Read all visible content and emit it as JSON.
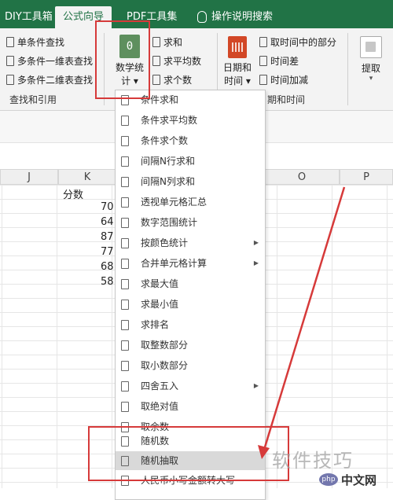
{
  "tabs": [
    {
      "label": "DIY工具箱"
    },
    {
      "label": "公式向导"
    },
    {
      "label": "PDF工具集"
    },
    {
      "label": "操作说明搜索"
    }
  ],
  "ribbon": {
    "lookup_group": {
      "items": [
        "单条件查找",
        "多条件一维表查找",
        "多条件二维表查找"
      ],
      "label": "查找和引用"
    },
    "math_button": {
      "icon_text": "0",
      "line1": "数学统",
      "line2": "计 ▾"
    },
    "math_small": [
      "求和",
      "求平均数",
      "求个数"
    ],
    "date_button": {
      "line1": "日期和",
      "line2": "时间 ▾"
    },
    "date_items": [
      "取时间中的部分",
      "时间差",
      "时间加减"
    ],
    "date_group_label": "期和时间",
    "extract_button": {
      "line1": "提取",
      "line2": "▾"
    }
  },
  "sheet": {
    "columns": [
      "J",
      "K",
      "O",
      "P"
    ],
    "header_cell": "分数",
    "values": [
      "70",
      "64",
      "87",
      "77",
      "68",
      "58"
    ]
  },
  "menu": {
    "items": [
      {
        "label": "条件求和",
        "arrow": ""
      },
      {
        "label": "条件求平均数",
        "arrow": ""
      },
      {
        "label": "条件求个数",
        "arrow": ""
      },
      {
        "label": "间隔N行求和",
        "arrow": ""
      },
      {
        "label": "间隔N列求和",
        "arrow": ""
      },
      {
        "label": "透视单元格汇总",
        "arrow": ""
      },
      {
        "label": "数字范围统计",
        "arrow": ""
      },
      {
        "label": "按颜色统计",
        "arrow": "▶"
      },
      {
        "label": "合并单元格计算",
        "arrow": "▶"
      },
      {
        "label": "求最大值",
        "arrow": ""
      },
      {
        "label": "求最小值",
        "arrow": ""
      },
      {
        "label": "求排名",
        "arrow": ""
      },
      {
        "label": "取整数部分",
        "arrow": ""
      },
      {
        "label": "取小数部分",
        "arrow": ""
      },
      {
        "label": "四舍五入",
        "arrow": "▶"
      },
      {
        "label": "取绝对值",
        "arrow": ""
      },
      {
        "label": "取余数",
        "arrow": ""
      },
      {
        "label": "随机数",
        "arrow": ""
      },
      {
        "label": "随机抽取",
        "arrow": ""
      },
      {
        "label": "人民币小写金额转大写",
        "arrow": ""
      }
    ]
  },
  "watermark": {
    "text": "软件技巧",
    "logo": "php",
    "site": "中文网"
  },
  "colors": {
    "ribbon_green": "#217346",
    "annotation_red": "#d63a3a",
    "highlight": "#d9d9d9"
  }
}
